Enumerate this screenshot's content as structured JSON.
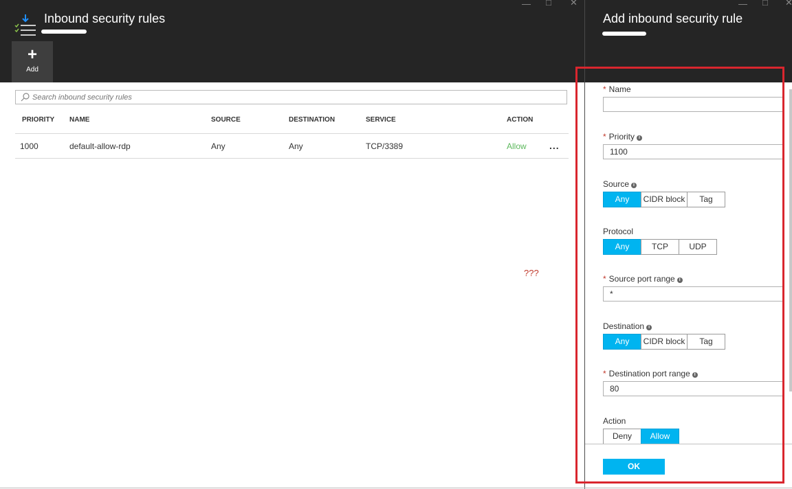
{
  "left_blade": {
    "title": "Inbound security rules",
    "add_label": "Add",
    "search_placeholder": "Search inbound security rules",
    "columns": [
      "PRIORITY",
      "NAME",
      "SOURCE",
      "DESTINATION",
      "SERVICE",
      "ACTION"
    ],
    "rows": [
      {
        "priority": "1000",
        "name": "default-allow-rdp",
        "source": "Any",
        "destination": "Any",
        "service": "TCP/3389",
        "action": "Allow",
        "more": "..."
      }
    ],
    "annotation": "???"
  },
  "right_blade": {
    "title": "Add inbound security rule",
    "fields": {
      "name": {
        "label": "Name",
        "value": ""
      },
      "priority": {
        "label": "Priority",
        "value": "1100"
      },
      "source": {
        "label": "Source",
        "options": [
          "Any",
          "CIDR block",
          "Tag"
        ],
        "selected": "Any"
      },
      "protocol": {
        "label": "Protocol",
        "options": [
          "Any",
          "TCP",
          "UDP"
        ],
        "selected": "Any"
      },
      "source_port_range": {
        "label": "Source port range",
        "value": "*"
      },
      "destination": {
        "label": "Destination",
        "options": [
          "Any",
          "CIDR block",
          "Tag"
        ],
        "selected": "Any"
      },
      "destination_port_range": {
        "label": "Destination port range",
        "value": "80"
      },
      "action": {
        "label": "Action",
        "options": [
          "Deny",
          "Allow"
        ],
        "selected": "Allow"
      }
    },
    "ok_label": "OK"
  },
  "colors": {
    "header_bg": "#252525",
    "accent": "#00b4f0",
    "allow_green": "#5cb85c",
    "highlight_red": "#d9262e",
    "required_red": "#c0392b"
  },
  "icons": [
    "inbound-rules-icon",
    "plus-icon",
    "search-icon",
    "info-icon",
    "minimize-icon",
    "maximize-icon",
    "close-icon",
    "more-icon"
  ]
}
